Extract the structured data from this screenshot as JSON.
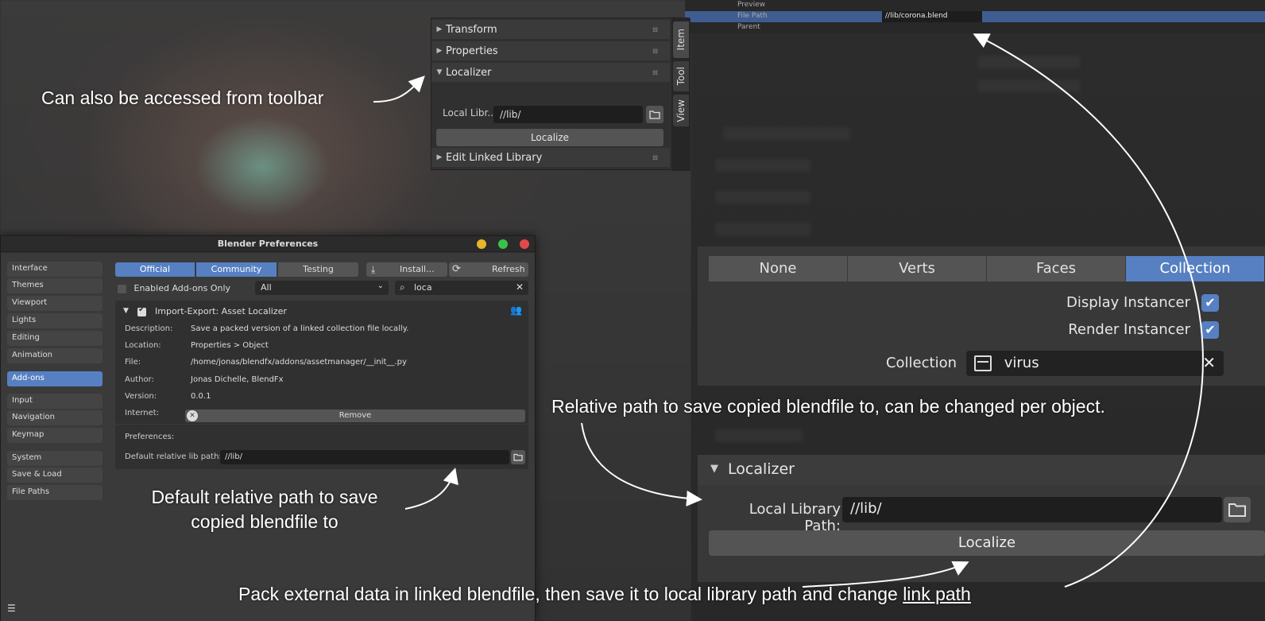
{
  "npanel": {
    "sections": [
      "Transform",
      "Properties",
      "Localizer",
      "Edit Linked Library"
    ],
    "local_lib_label": "Local Libr...",
    "local_lib_value": "//lib/",
    "localize_label": "Localize",
    "tabs": [
      "Item",
      "Tool",
      "View"
    ]
  },
  "top_strip": {
    "rows": [
      "Preview",
      "File Path",
      "Parent"
    ],
    "file_path_value": "//lib/corona.blend"
  },
  "prefs": {
    "title": "Blender Preferences",
    "sidebar": [
      "Interface",
      "Themes",
      "Viewport",
      "Lights",
      "Editing",
      "Animation",
      "Add-ons",
      "Input",
      "Navigation",
      "Keymap",
      "System",
      "Save & Load",
      "File Paths"
    ],
    "seg_tabs": [
      "Official",
      "Community",
      "Testing"
    ],
    "install_label": "Install...",
    "refresh_label": "Refresh",
    "enabled_only_label": "Enabled Add-ons Only",
    "category_value": "All",
    "search_value": "loca",
    "addon": {
      "name": "Import-Export: Asset Localizer",
      "description_label": "Description:",
      "description": "Save a packed version of a linked collection file locally.",
      "location_label": "Location:",
      "location": "Properties > Object",
      "file_label": "File:",
      "file": "/home/jonas/blendfx/addons/assetmanager/__init__.py",
      "author_label": "Author:",
      "author": "Jonas Dichelle, BlendFx",
      "version_label": "Version:",
      "version": "0.0.1",
      "internet_label": "Internet:",
      "remove_label": "Remove"
    },
    "preferences_label": "Preferences:",
    "default_lib_label": "Default relative lib path::",
    "default_lib_value": "//lib/"
  },
  "object_panel": {
    "tabs": [
      "None",
      "Verts",
      "Faces",
      "Collection"
    ],
    "display_instancer": "Display Instancer",
    "render_instancer": "Render Instancer",
    "collection_label": "Collection",
    "collection_value": "virus"
  },
  "localizer_panel": {
    "title": "Localizer",
    "local_lib_label": "Local Library Path:",
    "local_lib_value": "//lib/",
    "localize_label": "Localize"
  },
  "annotations": {
    "toolbar": "Can also be accessed from toolbar",
    "relative_path": "Relative path to save copied blendfile to, can be changed per object.",
    "default_path_line1": "Default relative path to save",
    "default_path_line2": "copied blendfile to",
    "pack_text": "Pack external data in linked blendfile, then save it to local library path and change ",
    "pack_link": "link path"
  },
  "colors": {
    "accent": "#5680c2",
    "traffic_yellow": "#e7b52c",
    "traffic_green": "#38c24a",
    "traffic_red": "#e24a4a"
  }
}
